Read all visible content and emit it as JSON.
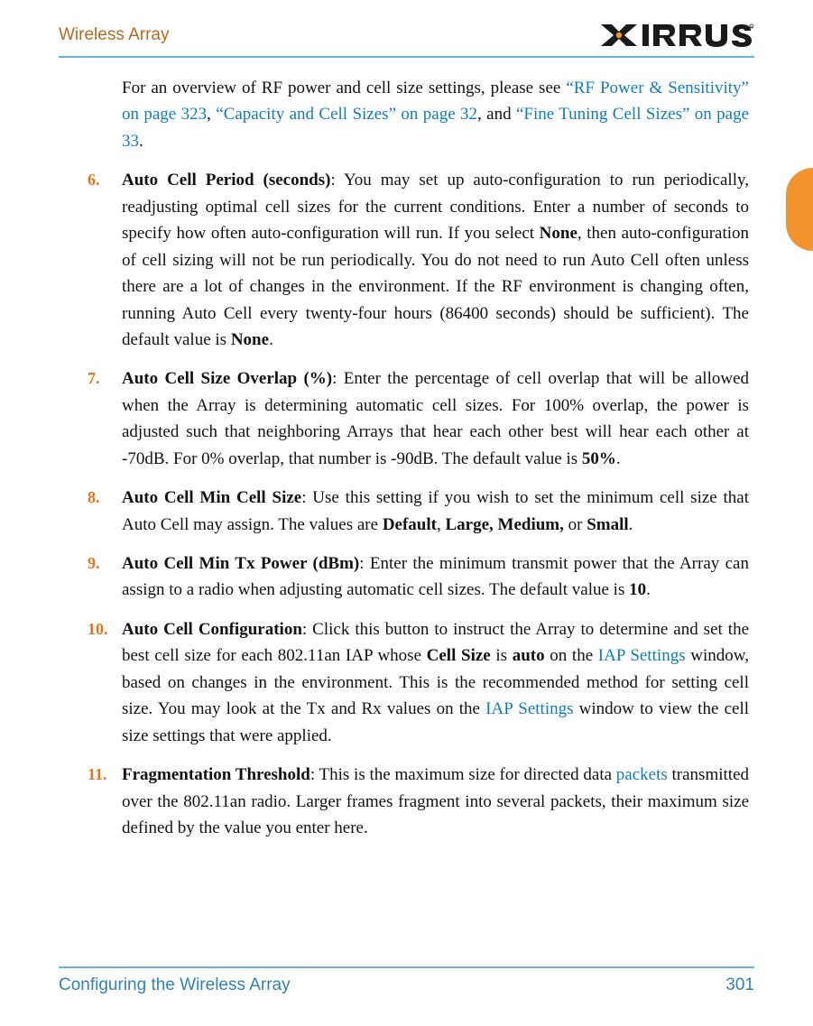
{
  "header": {
    "left": "Wireless Array",
    "brand": "XIRRUS"
  },
  "intro": {
    "pre": "For an overview of RF power and cell size settings, please see ",
    "link1": "“RF Power & Sensitivity” on page 323",
    "mid1": ", ",
    "link2": "“Capacity and Cell Sizes” on page 32",
    "mid2": ", and ",
    "link3": "“Fine Tuning Cell Sizes” on page 33",
    "post": "."
  },
  "items": {
    "i6": {
      "num": "6.",
      "title": "Auto Cell Period (seconds)",
      "body_a": ": You may set up auto-configuration to run periodically, readjusting optimal cell sizes for the current conditions. Enter a number of seconds to specify how often auto-configuration will run. If you select ",
      "bold1": "None",
      "body_b": ", then auto-configuration of cell sizing will not be run periodically. You do not need to run Auto Cell often unless there are a lot of changes in the environment. If the RF environment is changing often, running Auto Cell every twenty-four hours (86400 seconds) should be sufficient). The default value is ",
      "bold2": "None",
      "body_c": "."
    },
    "i7": {
      "num": "7.",
      "title": "Auto Cell Size Overlap (%)",
      "body_a": ": Enter the percentage of cell overlap that will be allowed when the Array is determining automatic cell sizes. For 100% overlap, the power is adjusted such that neighboring Arrays that hear each other best will hear each other at -70dB. For 0% overlap, that number is -90dB. The default value is ",
      "bold1": "50%",
      "body_b": "."
    },
    "i8": {
      "num": "8.",
      "title": "Auto Cell Min Cell Size",
      "body_a": ": Use this setting if you wish to set the minimum cell size that Auto Cell may assign. The values are ",
      "bold1": "Default",
      "body_b": ", ",
      "bold2": "Large, Medium,",
      "body_c": " or ",
      "bold3": "Small",
      "body_d": "."
    },
    "i9": {
      "num": "9.",
      "title": "Auto Cell Min Tx Power (dBm)",
      "body_a": ": Enter the minimum transmit power that the Array can assign to a radio when adjusting automatic cell sizes. The default value is ",
      "bold1": "10",
      "body_b": "."
    },
    "i10": {
      "num": "10.",
      "title": "Auto Cell Configuration",
      "body_a": ": Click this button to instruct the Array to determine and set the best cell size for each 802.11an IAP whose ",
      "bold1": "Cell Size",
      "body_b": " is ",
      "bold2": "auto",
      "body_c": " on the ",
      "link1": "IAP Settings",
      "body_d": " window, based on changes in the environment. This is the recommended method for setting cell size. You may look at the Tx and Rx values on the ",
      "link2": "IAP Settings",
      "body_e": " window to view the cell size settings that were applied."
    },
    "i11": {
      "num": "11.",
      "title": "Fragmentation Threshold",
      "body_a": ": This is the maximum size for directed data ",
      "link1": "packets",
      "body_b": " transmitted over the 802.11an radio. Larger frames fragment into several packets, their maximum size defined by the value you enter here."
    }
  },
  "footer": {
    "left": "Configuring the Wireless Array",
    "right": "301"
  }
}
